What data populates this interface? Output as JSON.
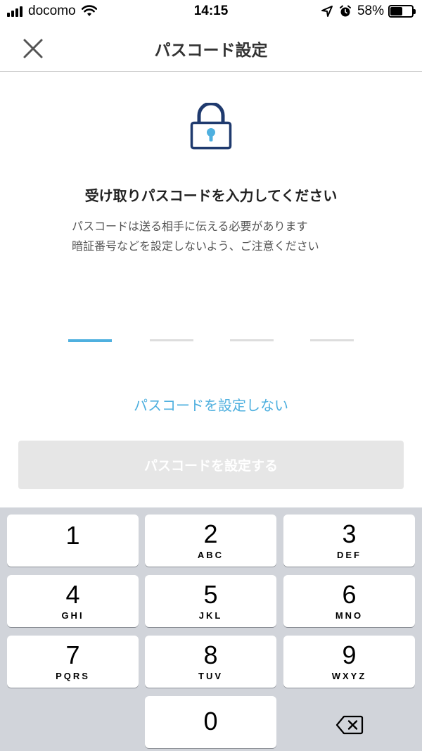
{
  "status_bar": {
    "carrier": "docomo",
    "time": "14:15",
    "battery_percent": "58%",
    "battery_level": 0.58
  },
  "nav": {
    "title": "パスコード設定",
    "close_icon": "close-icon"
  },
  "content": {
    "icon": "lock-icon",
    "heading": "受け取りパスコードを入力してください",
    "description_line1": "パスコードは送る相手に伝える必要があります",
    "description_line2": "暗証番号などを設定しないよう、ご注意ください",
    "code_length": 4,
    "active_slot": 0
  },
  "actions": {
    "skip_label": "パスコードを設定しない",
    "submit_label": "パスコードを設定する"
  },
  "keypad": {
    "keys": [
      {
        "digit": "1",
        "letters": ""
      },
      {
        "digit": "2",
        "letters": "ABC"
      },
      {
        "digit": "3",
        "letters": "DEF"
      },
      {
        "digit": "4",
        "letters": "GHI"
      },
      {
        "digit": "5",
        "letters": "JKL"
      },
      {
        "digit": "6",
        "letters": "MNO"
      },
      {
        "digit": "7",
        "letters": "PQRS"
      },
      {
        "digit": "8",
        "letters": "TUV"
      },
      {
        "digit": "9",
        "letters": "WXYZ"
      },
      {
        "digit": "0",
        "letters": ""
      }
    ],
    "delete_icon": "backspace-icon"
  },
  "colors": {
    "accent": "#4fb0df",
    "lock_navy": "#1f3a6e",
    "disabled_button": "#e6e6e6",
    "keypad_bg": "#d1d4da"
  }
}
